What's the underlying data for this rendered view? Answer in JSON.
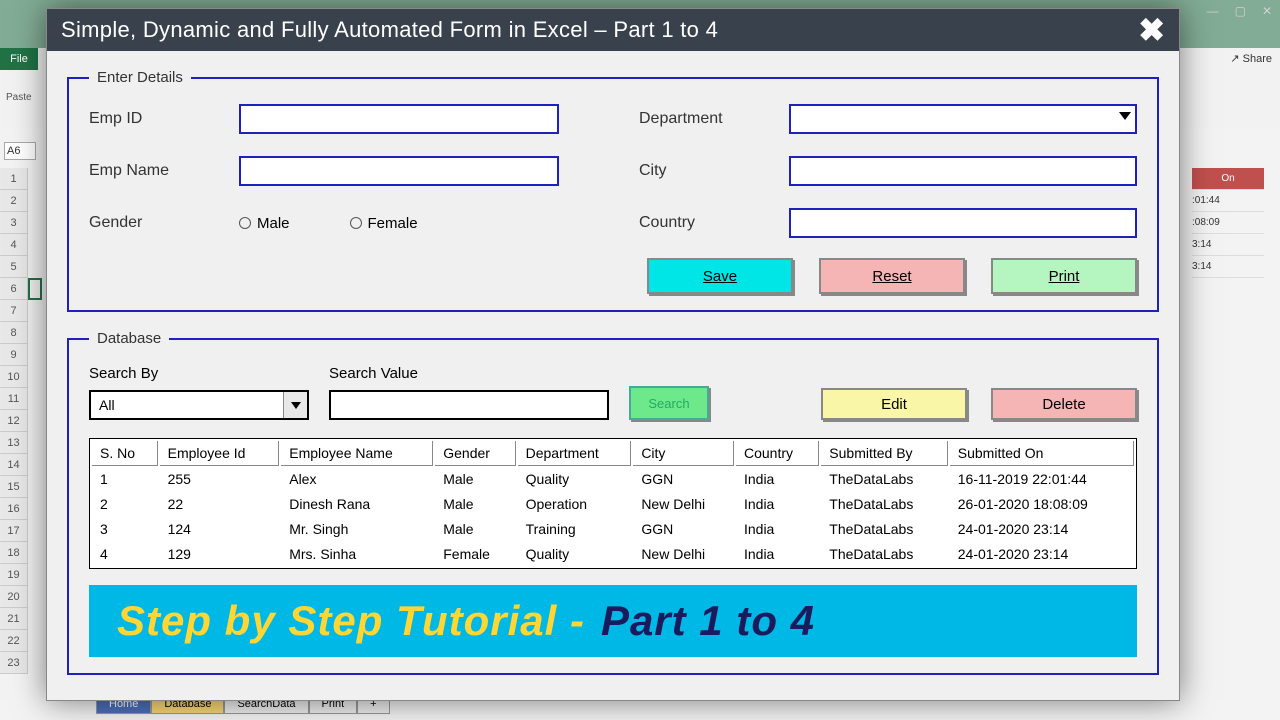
{
  "title": "Simple, Dynamic and Fully Automated Form in Excel – Part 1 to 4",
  "details": {
    "legend": "Enter Details",
    "emp_id_label": "Emp ID",
    "emp_name_label": "Emp Name",
    "gender_label": "Gender",
    "gender_male": "Male",
    "gender_female": "Female",
    "department_label": "Department",
    "city_label": "City",
    "country_label": "Country",
    "save": "Save",
    "reset": "Reset",
    "print": "Print"
  },
  "database": {
    "legend": "Database",
    "search_by_label": "Search By",
    "search_by_value": "All",
    "search_value_label": "Search Value",
    "search_btn": "Search",
    "edit": "Edit",
    "delete": "Delete",
    "headers": [
      "S. No",
      "Employee Id",
      "Employee Name",
      "Gender",
      "Department",
      "City",
      "Country",
      "Submitted By",
      "Submitted On"
    ],
    "rows": [
      {
        "sno": "1",
        "id": "255",
        "name": "Alex",
        "gender": "Male",
        "dept": "Quality",
        "city": "GGN",
        "country": "India",
        "by": "TheDataLabs",
        "on": "16-11-2019 22:01:44"
      },
      {
        "sno": "2",
        "id": "22",
        "name": "Dinesh Rana",
        "gender": "Male",
        "dept": "Operation",
        "city": "New Delhi",
        "country": "India",
        "by": "TheDataLabs",
        "on": "26-01-2020 18:08:09"
      },
      {
        "sno": "3",
        "id": "124",
        "name": "Mr. Singh",
        "gender": "Male",
        "dept": "Training",
        "city": "GGN",
        "country": "India",
        "by": "TheDataLabs",
        "on": "24-01-2020 23:14"
      },
      {
        "sno": "4",
        "id": "129",
        "name": "Mrs. Sinha",
        "gender": "Female",
        "dept": "Quality",
        "city": "New Delhi",
        "country": "India",
        "by": "TheDataLabs",
        "on": "24-01-2020 23:14"
      }
    ]
  },
  "banner": {
    "t1": "Step by Step Tutorial - ",
    "t2": "Part 1 to 4"
  },
  "bg": {
    "file": "File",
    "namebox": "A6",
    "share": "Share",
    "paste": "Paste",
    "tabs": {
      "home": "Home",
      "database": "Database",
      "searchdata": "SearchData",
      "print": "Print",
      "plus": "+"
    },
    "rcol_hdr": "On",
    "rcol": [
      ":01:44",
      ":08:09",
      "3:14",
      "3:14"
    ],
    "rows": [
      "1",
      "2",
      "3",
      "4",
      "5",
      "6",
      "7",
      "8",
      "9",
      "10",
      "11",
      "12",
      "13",
      "14",
      "15",
      "16",
      "17",
      "18",
      "19",
      "20",
      "21",
      "22",
      "23"
    ]
  }
}
